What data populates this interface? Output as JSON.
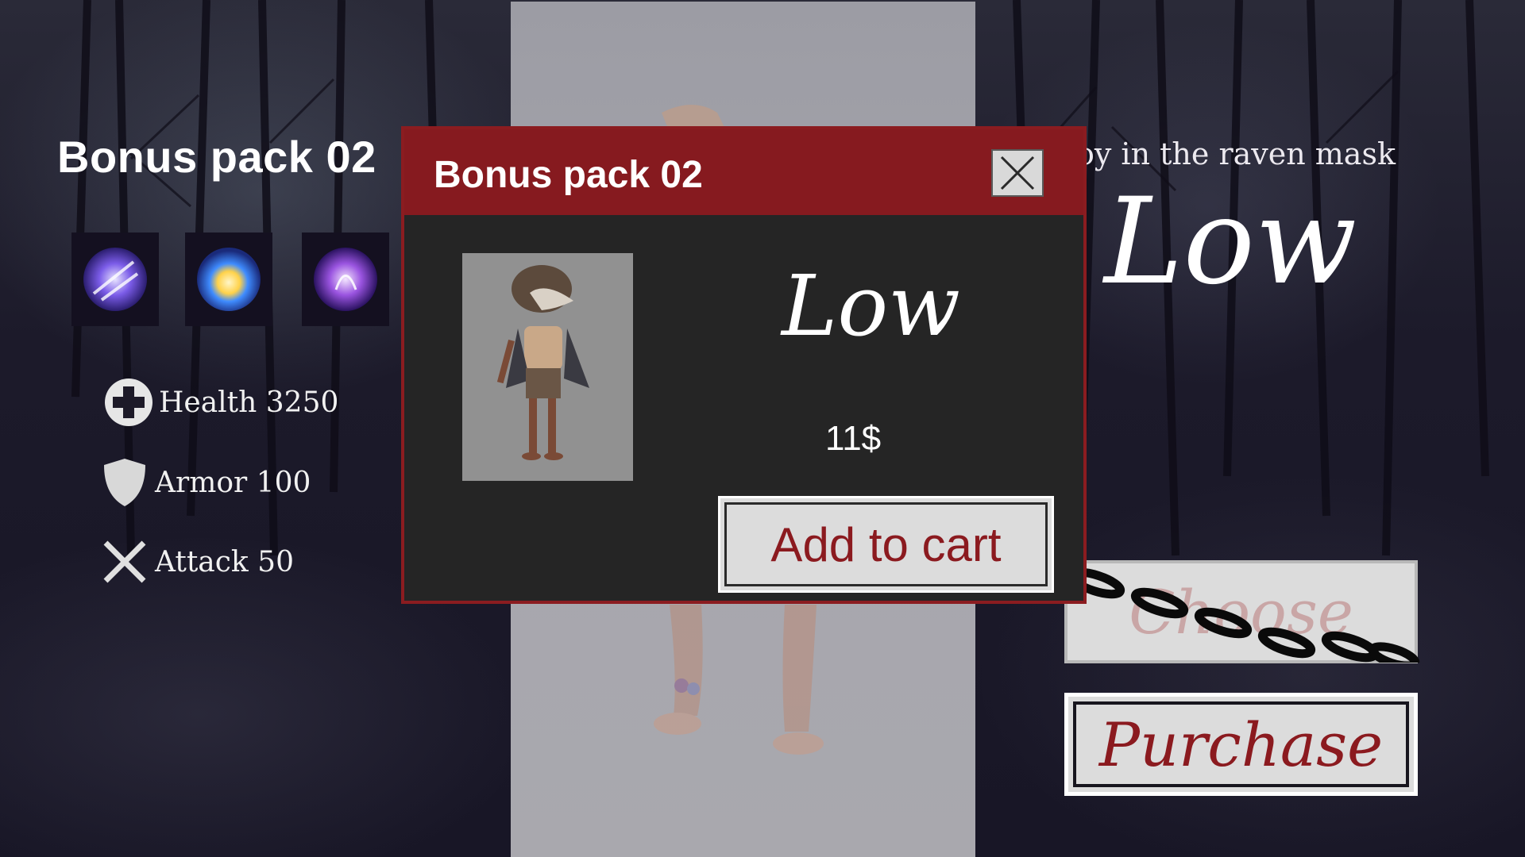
{
  "left_panel": {
    "title": "Bonus pack 02",
    "skills": [
      {
        "icon": "skill-slash-icon"
      },
      {
        "icon": "skill-burst-icon"
      },
      {
        "icon": "skill-spirit-icon"
      }
    ],
    "stats": [
      {
        "icon": "health-cross-icon",
        "label": "Health 3250"
      },
      {
        "icon": "armor-shield-icon",
        "label": "Armor 100"
      },
      {
        "icon": "attack-swords-icon",
        "label": "Attack  50"
      }
    ]
  },
  "right_panel": {
    "subtitle": "oy in the raven mask",
    "name": "Low",
    "choose_label": "Choose",
    "purchase_label": "Purchase"
  },
  "modal": {
    "title": "Bonus pack 02",
    "close_icon": "close-icon",
    "item_name": "Low",
    "price": "11$",
    "add_to_cart_label": "Add to cart"
  },
  "colors": {
    "accent_red": "#861a1f",
    "modal_body": "#252525",
    "button_bg": "#dcdcdc",
    "text_light": "#ffffff"
  }
}
